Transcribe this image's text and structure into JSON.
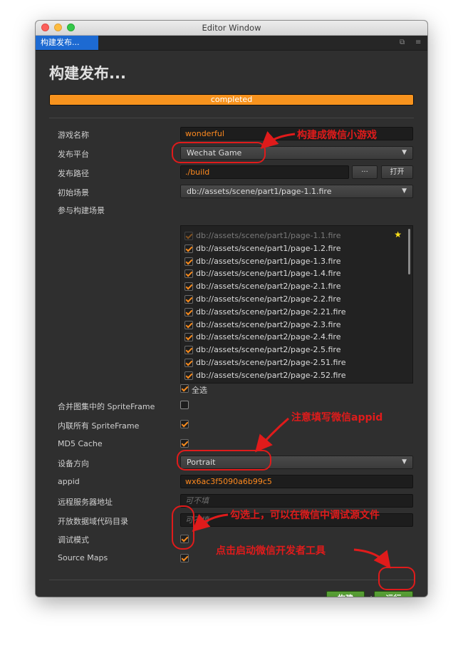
{
  "window": {
    "title": "Editor Window"
  },
  "tab": {
    "label": "构建发布..."
  },
  "panel": {
    "title": "构建发布..."
  },
  "progress": {
    "text": "completed",
    "value": 1.0
  },
  "form": {
    "game_name": {
      "label": "游戏名称",
      "value": "wonderful"
    },
    "platform": {
      "label": "发布平台",
      "value": "Wechat Game"
    },
    "build_path": {
      "label": "发布路径",
      "value": "./build",
      "browse_label": "···",
      "open_label": "打开"
    },
    "start_scene": {
      "label": "初始场景",
      "value": "db://assets/scene/part1/page-1.1.fire"
    },
    "scenes": {
      "label": "参与构建场景",
      "items": [
        {
          "path": "db://assets/scene/part1/page-1.1.fire",
          "checked": true,
          "disabled": true
        },
        {
          "path": "db://assets/scene/part1/page-1.2.fire",
          "checked": true
        },
        {
          "path": "db://assets/scene/part1/page-1.3.fire",
          "checked": true
        },
        {
          "path": "db://assets/scene/part1/page-1.4.fire",
          "checked": true
        },
        {
          "path": "db://assets/scene/part2/page-2.1.fire",
          "checked": true
        },
        {
          "path": "db://assets/scene/part2/page-2.2.fire",
          "checked": true
        },
        {
          "path": "db://assets/scene/part2/page-2.21.fire",
          "checked": true
        },
        {
          "path": "db://assets/scene/part2/page-2.3.fire",
          "checked": true
        },
        {
          "path": "db://assets/scene/part2/page-2.4.fire",
          "checked": true
        },
        {
          "path": "db://assets/scene/part2/page-2.5.fire",
          "checked": true
        },
        {
          "path": "db://assets/scene/part2/page-2.51.fire",
          "checked": true
        },
        {
          "path": "db://assets/scene/part2/page-2.52.fire",
          "checked": true
        }
      ],
      "select_all_label": "全选"
    },
    "merge_spriteframe": {
      "label": "合并图集中的 SpriteFrame",
      "checked": false
    },
    "inline_spriteframe": {
      "label": "内联所有 SpriteFrame",
      "checked": true
    },
    "md5_cache": {
      "label": "MD5 Cache",
      "checked": true
    },
    "orientation": {
      "label": "设备方向",
      "value": "Portrait"
    },
    "appid": {
      "label": "appid",
      "value": "wx6ac3f5090a6b99c5"
    },
    "remote_server": {
      "label": "远程服务器地址",
      "placeholder": "可不填"
    },
    "open_data_dir": {
      "label": "开放数据域代码目录",
      "placeholder": "可不填"
    },
    "debug_mode": {
      "label": "调试模式",
      "checked": true
    },
    "source_maps": {
      "label": "Source Maps",
      "checked": true
    }
  },
  "actions": {
    "build_label": "构建",
    "run_label": "运行"
  },
  "annotations": {
    "platform_note": "构建成微信小游戏",
    "appid_note": "注意填写微信appid",
    "debug_note": "勾选上，可以在微信中调试源文件",
    "run_note": "点击启动微信开发者工具"
  },
  "colors": {
    "accent_orange": "#f7931e",
    "annotation_red": "#e01b1b",
    "tab_blue": "#1d6ad2",
    "run_green": "#4a9a2c"
  }
}
